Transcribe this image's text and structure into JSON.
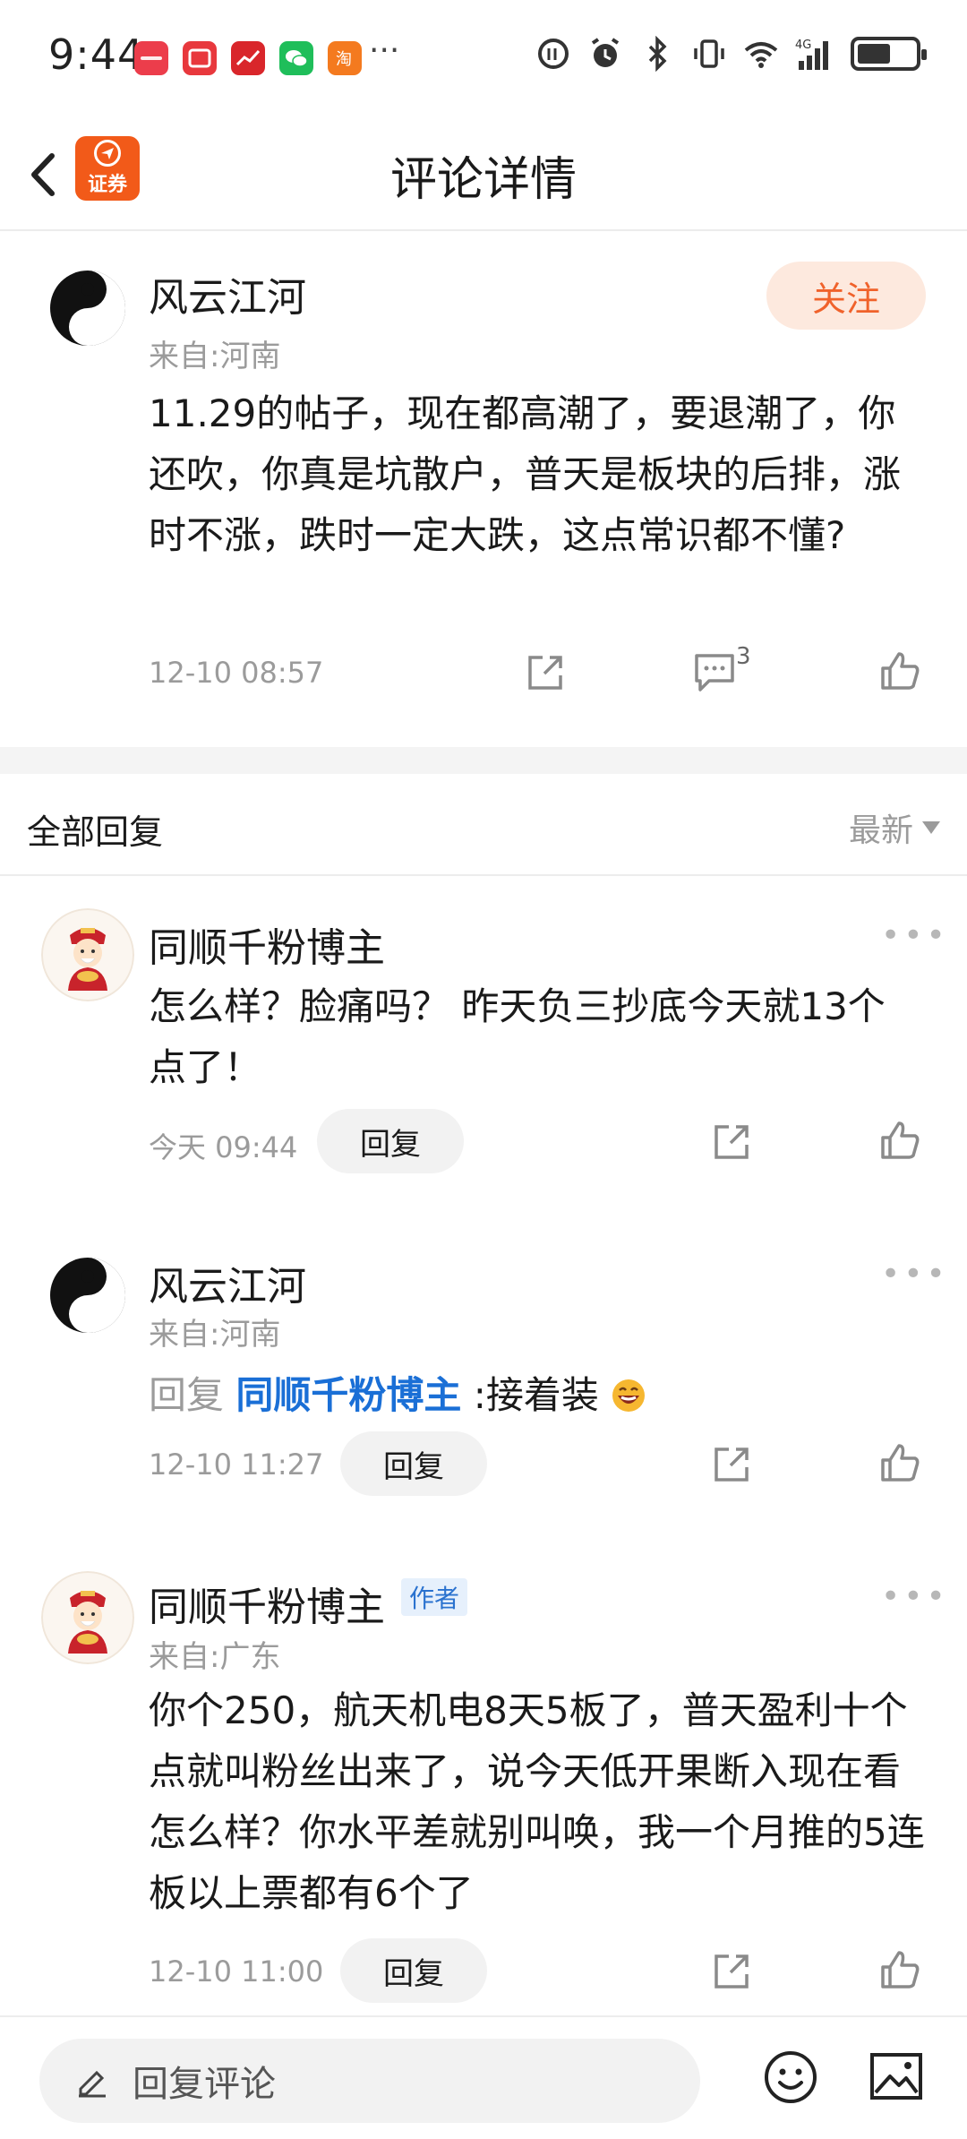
{
  "status_bar": {
    "time": "9:44",
    "app_icons": [
      "huawei-app-icon",
      "red-app-icon",
      "stock-app-icon",
      "wechat-icon",
      "taobao-icon"
    ],
    "more": "···"
  },
  "nav": {
    "title": "评论详情",
    "logo_text": "证券"
  },
  "main_comment": {
    "user": "风云江河",
    "origin": "来自:河南",
    "follow_label": "关注",
    "text": "11.29的帖子，现在都高潮了，要退潮了，你还吹，你真是坑散户，普天是板块的后排，涨时不涨，跌时一定大跌，这点常识都不懂?",
    "time": "12-10 08:57",
    "comment_count": "3"
  },
  "replies_header": {
    "title": "全部回复",
    "sort_label": "最新"
  },
  "replies": [
    {
      "user": "同顺千粉博主",
      "text": "怎么样？脸痛吗？ 昨天负三抄底今天就13个点了！",
      "time": "今天 09:44",
      "reply_label": "回复"
    },
    {
      "user": "风云江河",
      "origin": "来自:河南",
      "reply_prefix": "回复",
      "reply_target": "同顺千粉博主",
      "text": ":接着装",
      "time": "12-10 11:27",
      "reply_label": "回复"
    },
    {
      "user": "同顺千粉博主",
      "author_tag": "作者",
      "origin": "来自:广东",
      "text": "你个250，航天机电8天5板了，普天盈利十个点就叫粉丝出来了，说今天低开果断入现在看怎么样？你水平差就别叫唤，我一个月推的5连板以上票都有6个了",
      "time": "12-10 11:00",
      "reply_label": "回复"
    }
  ],
  "bottom_bar": {
    "input_placeholder": "回复评论"
  },
  "colors": {
    "accent": "#f0622b",
    "link": "#1a6fd6",
    "muted": "#9b9b9b"
  }
}
